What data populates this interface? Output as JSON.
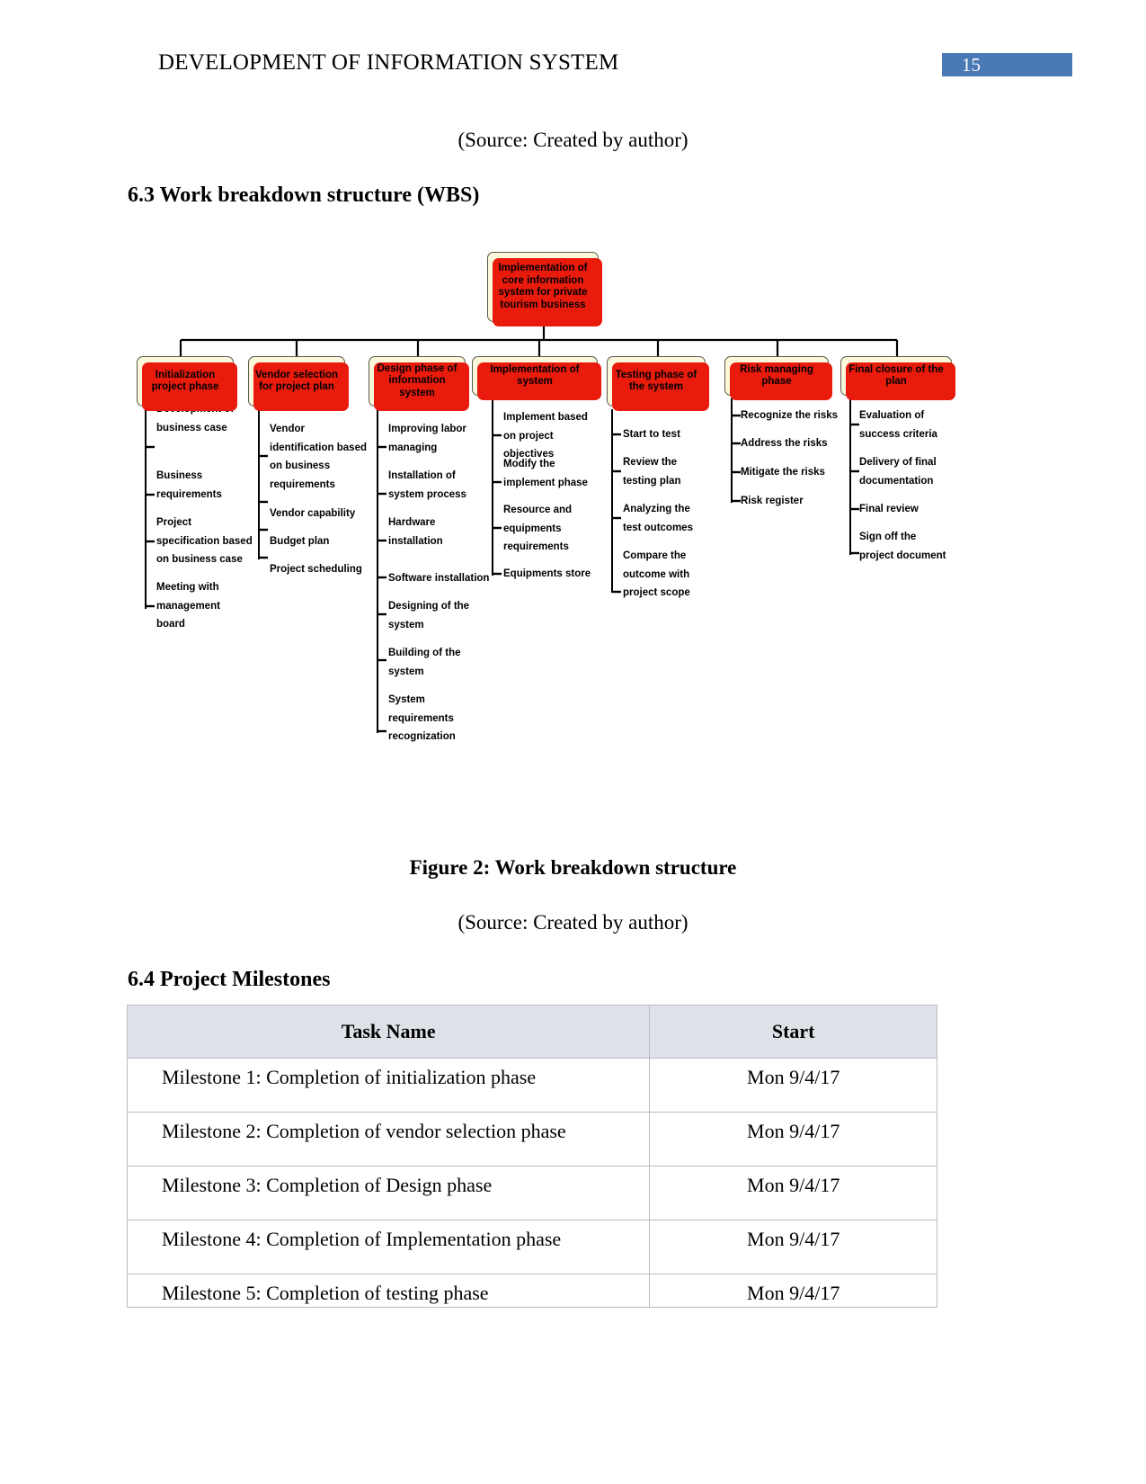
{
  "header": {
    "title": "DEVELOPMENT OF INFORMATION SYSTEM",
    "page_number": "15",
    "page_number_color": "#4a7ab5"
  },
  "body": {
    "source_note_top": "(Source: Created by author)",
    "heading_wbs": "6.3 Work breakdown structure (WBS)",
    "figure_caption": "Figure 2: Work breakdown structure",
    "source_note_figure": "(Source: Created by author)",
    "heading_milestones": "6.4 Project Milestones"
  },
  "wbs": {
    "node_fill": "#fbf8dc",
    "node_shadow": "#e81b0d",
    "root": "Implementation of core information system for private tourism business",
    "branches": [
      {
        "title": "Initialization project phase",
        "items": [
          "Development of business case",
          "Business requirements",
          "Project specification based on business case",
          "Meeting with management board"
        ]
      },
      {
        "title": "Vendor selection for project plan",
        "items": [
          "Vendor identification based on business requirements",
          "Vendor capability",
          "Budget plan",
          "Project scheduling"
        ]
      },
      {
        "title": "Design phase of information system",
        "items": [
          "Improving labor managing",
          "Installation of system process",
          "Hardware installation",
          "Software installation",
          "Designing of the system",
          "Building of the system",
          "System requirements recognization"
        ]
      },
      {
        "title": "Implementation of system",
        "items": [
          "Implement based on project objectives",
          "Modify the implement phase",
          "Resource and equipments requirements",
          "Equipments store"
        ]
      },
      {
        "title": "Testing phase of the system",
        "items": [
          "Start to test",
          "Review the testing plan",
          "Analyzing the test outcomes",
          "Compare the outcome with project scope"
        ]
      },
      {
        "title": "Risk managing phase",
        "items": [
          "Recognize the risks",
          "Address the risks",
          "Mitigate the risks",
          "Risk register"
        ]
      },
      {
        "title": "Final closure of the plan",
        "items": [
          "Evaluation of success criteria",
          "Delivery of final documentation",
          "Final review",
          "Sign off the project document"
        ]
      }
    ]
  },
  "milestones": {
    "columns": [
      "Task Name",
      "Start"
    ],
    "rows": [
      {
        "task": "Milestone 1: Completion of initialization phase",
        "start": "Mon 9/4/17"
      },
      {
        "task": "Milestone 2: Completion of vendor selection phase",
        "start": "Mon 9/4/17"
      },
      {
        "task": "Milestone 3: Completion of Design phase",
        "start": "Mon 9/4/17"
      },
      {
        "task": "Milestone 4: Completion of Implementation phase",
        "start": "Mon 9/4/17"
      },
      {
        "task": "Milestone 5: Completion of testing phase",
        "start": "Mon 9/4/17"
      }
    ]
  }
}
